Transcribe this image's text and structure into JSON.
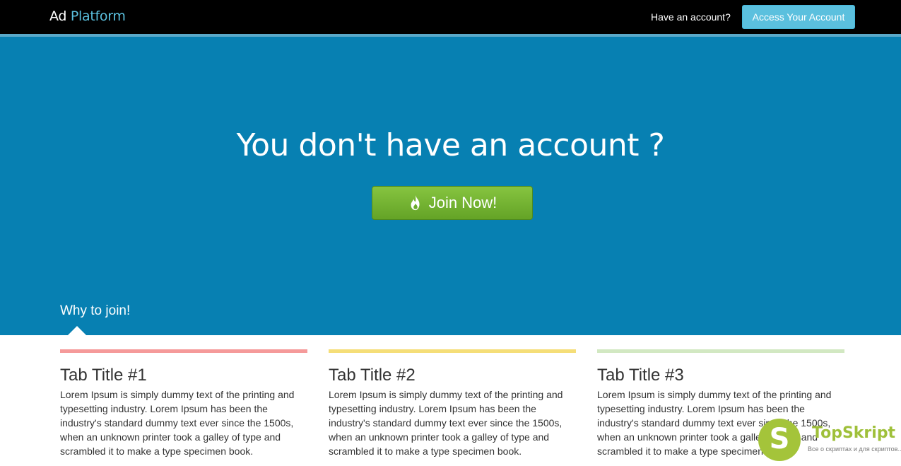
{
  "header": {
    "logo_part1": "Ad",
    "logo_part2": "Platform",
    "have_account": "Have an account?",
    "access_button": "Access Your Account"
  },
  "hero": {
    "title": "You don't have an account ?",
    "join_button": "Join Now!",
    "join_icon": "fire-icon",
    "why_label": "Why to join!"
  },
  "features": [
    {
      "color": "#f59a9a",
      "title": "Tab Title #1",
      "text": "Lorem Ipsum is simply dummy text of the printing and typesetting industry. Lorem Ipsum has been the industry's standard dummy text ever since the 1500s, when an unknown printer took a galley of type and scrambled it to make a type specimen book."
    },
    {
      "color": "#f5de78",
      "title": "Tab Title #2",
      "text": "Lorem Ipsum is simply dummy text of the printing and typesetting industry. Lorem Ipsum has been the industry's standard dummy text ever since the 1500s, when an unknown printer took a galley of type and scrambled it to make a type specimen book."
    },
    {
      "color": "#d2e8c2",
      "title": "Tab Title #3",
      "text": "Lorem Ipsum is simply dummy text of the printing and typesetting industry. Lorem Ipsum has been the industry's standard dummy text ever since the 1500s, when an unknown printer took a galley of type and scrambled it to make a type specimen book."
    }
  ],
  "watermark": {
    "badge": "S",
    "name": "TopSkript",
    "tagline": "Все о скриптах и для скриптов..."
  },
  "colors": {
    "topbar": "#000000",
    "hero_bg": "#0780b2",
    "accent": "#5bc0de",
    "join_green": "#6aac2b"
  }
}
